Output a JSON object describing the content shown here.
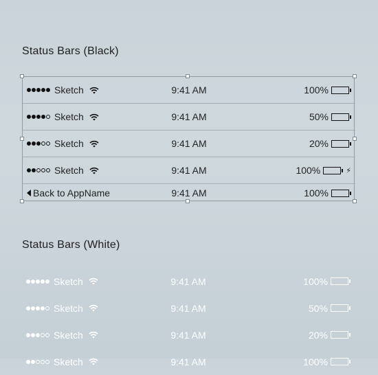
{
  "sections": {
    "black_title": "Status Bars (Black)",
    "white_title": "Status Bars (White)"
  },
  "black_rows": [
    {
      "carrier": "Sketch",
      "time": "9:41 AM",
      "percent": "100%",
      "signal_filled": 5,
      "battery_level": 1.0,
      "battery_color": "#111111",
      "charging": false
    },
    {
      "carrier": "Sketch",
      "time": "9:41 AM",
      "percent": "50%",
      "signal_filled": 4,
      "battery_level": 0.5,
      "battery_color": "#f4c20d",
      "charging": false
    },
    {
      "carrier": "Sketch",
      "time": "9:41 AM",
      "percent": "20%",
      "signal_filled": 3,
      "battery_level": 0.2,
      "battery_color": "#e53935",
      "charging": false
    },
    {
      "carrier": "Sketch",
      "time": "9:41 AM",
      "percent": "100%",
      "signal_filled": 2,
      "battery_level": 1.0,
      "battery_color": "#3ec24c",
      "charging": true
    },
    {
      "back_label": "Back to AppName",
      "time": "9:41 AM",
      "percent": "100%",
      "battery_level": 1.0,
      "battery_color": "#111111",
      "charging": false
    }
  ],
  "white_rows": [
    {
      "carrier": "Sketch",
      "time": "9:41 AM",
      "percent": "100%",
      "signal_filled": 5,
      "battery_level": 1.0,
      "battery_color": "#ffffff"
    },
    {
      "carrier": "Sketch",
      "time": "9:41 AM",
      "percent": "50%",
      "signal_filled": 4,
      "battery_level": 0.5,
      "battery_color": "#f4c20d"
    },
    {
      "carrier": "Sketch",
      "time": "9:41 AM",
      "percent": "20%",
      "signal_filled": 3,
      "battery_level": 0.2,
      "battery_color": "#e53935"
    },
    {
      "carrier": "Sketch",
      "time": "9:41 AM",
      "percent": "100%",
      "signal_filled": 2,
      "battery_level": 1.0,
      "battery_color": "#3ec24c"
    }
  ],
  "icons": {
    "wifi": "wifi-icon",
    "battery": "battery-icon",
    "bolt": "charging-bolt-icon",
    "back": "back-arrow-icon"
  }
}
